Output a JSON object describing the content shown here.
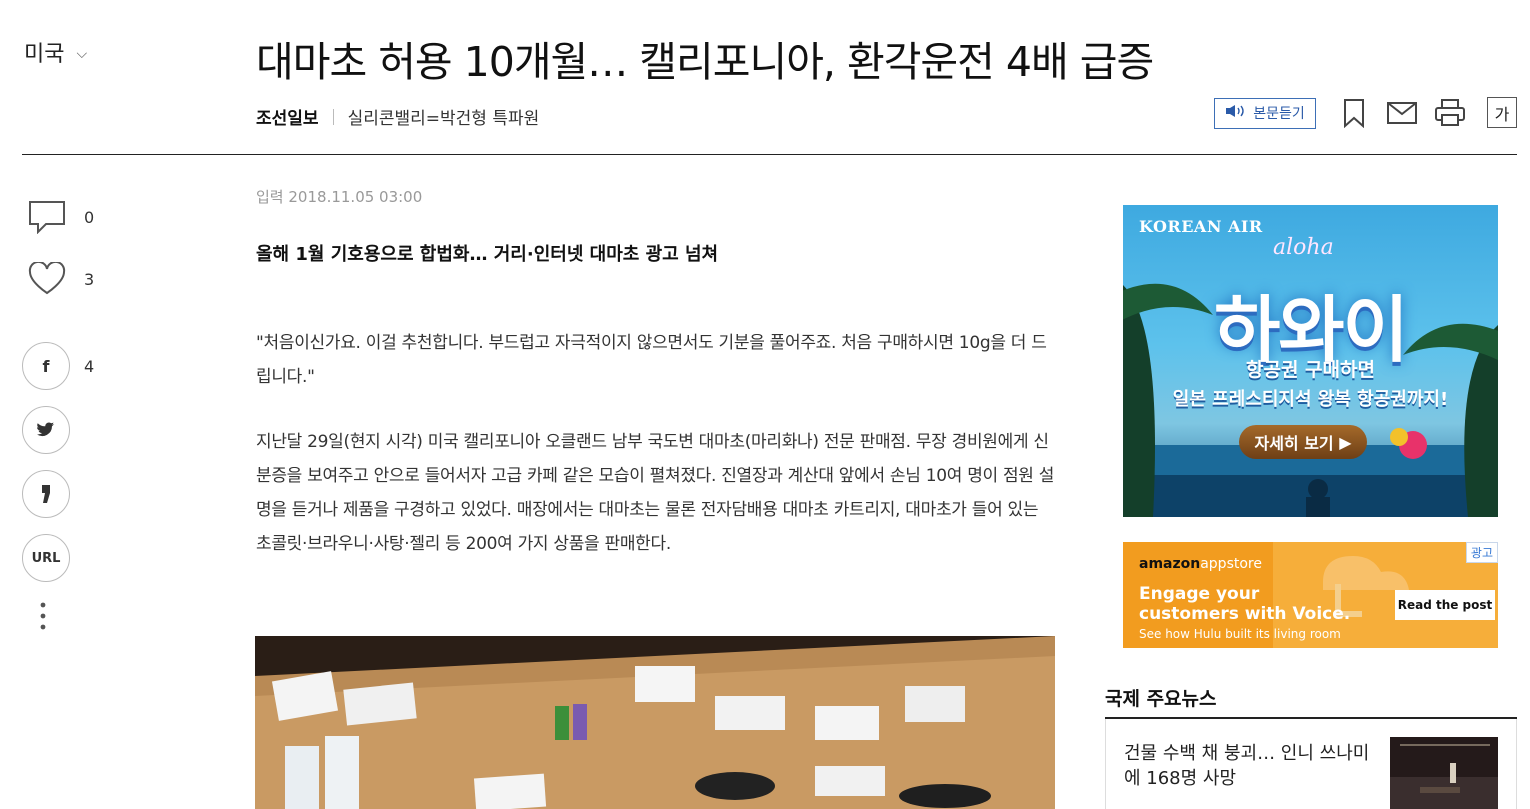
{
  "nav": {
    "section": "미국"
  },
  "article": {
    "headline": "대마초 허용 10개월… 캘리포니아, 환각운전 4배 급증",
    "source": "조선일보",
    "reporter": "실리콘밸리=박건형 특파원",
    "date_label": "입력",
    "date": "2018.11.05 03:00",
    "subhead": "올해 1월 기호용으로 합법화… 거리·인터넷 대마초 광고 넘쳐",
    "paragraphs": [
      "\"처음이신가요. 이걸 추천합니다. 부드럽고 자극적이지 않으면서도 기분을 풀어주죠. 처음 구매하시면 10g을 더 드립니다.\"",
      "지난달 29일(현지 시각) 미국 캘리포니아 오클랜드 남부 국도변 대마초(마리화나) 전문 판매점. 무장 경비원에게 신분증을 보여주고 안으로 들어서자 고급 카페 같은 모습이 펼쳐졌다. 진열장과 계산대 앞에서 손님 10여 명이 점원 설명을 듣거나 제품을 구경하고 있었다. 매장에서는 대마초는 물론 전자담배용 대마초 카트리지, 대마초가 들어 있는 초콜릿·브라우니·사탕·젤리 등 200여 가지 상품을 판매한다."
    ]
  },
  "toolbar": {
    "listen_label": "본문듣기",
    "font_label": "가",
    "icons": [
      "speaker-icon",
      "bookmark-icon",
      "mail-icon",
      "print-icon"
    ]
  },
  "social": {
    "comment_count": "0",
    "like_count": "3",
    "facebook_count": "4",
    "url_label": "URL"
  },
  "ads": {
    "korean_air": {
      "brand": "KOREAN AIR",
      "script": "aloha",
      "title": "하와이",
      "line1": "항공권 구매하면",
      "line2": "일본 프레스티지석 왕복 항공권까지!",
      "cta": "자세히 보기"
    },
    "amazon": {
      "logo": "amazon",
      "logo_suffix": "appstore",
      "headline_1": "Engage your",
      "headline_2": "customers with Voice.",
      "sub": "See how Hulu built its living room",
      "button": "Read the post",
      "label": "광고"
    }
  },
  "news": {
    "title": "국제 주요뉴스",
    "items": [
      {
        "title": "건물 수백 채 붕괴… 인니 쓰나미에 168명 사망"
      }
    ]
  },
  "colors": {
    "accent_blue": "#2a5aa8",
    "ad_orange": "#f29c1f"
  }
}
